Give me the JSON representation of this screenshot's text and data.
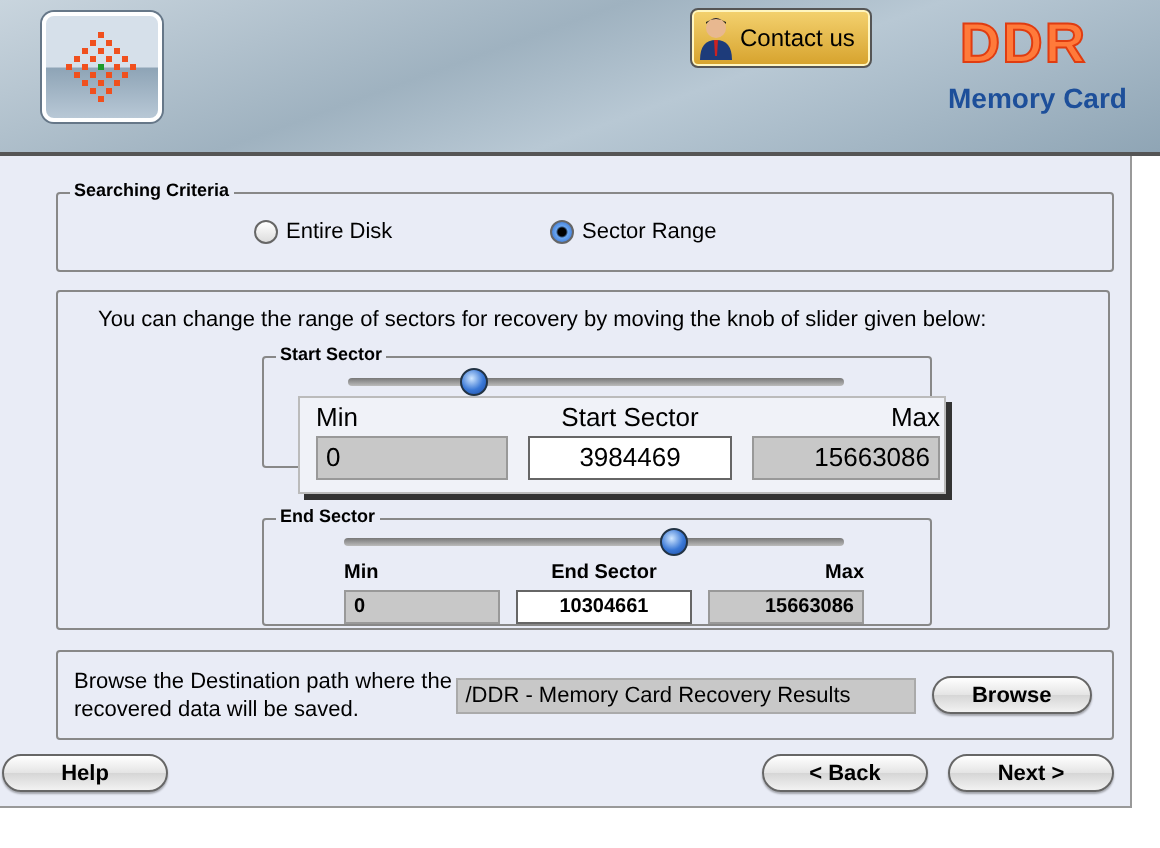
{
  "header": {
    "contact_button": "Contact us",
    "brand": "DDR",
    "product": "Memory Card"
  },
  "searching_criteria": {
    "title": "Searching Criteria",
    "options": [
      {
        "label": "Entire Disk",
        "selected": false
      },
      {
        "label": "Sector Range",
        "selected": true
      }
    ]
  },
  "sector_range": {
    "instruction": "You can change the range of sectors for recovery by moving the knob of slider given below:",
    "start_sector": {
      "title": "Start Sector",
      "level": 0.254
    },
    "magnifier": {
      "min_label": "Min",
      "value_label": "Start Sector",
      "max_label": "Max",
      "min": "0",
      "value": "3984469",
      "max": "15663086"
    },
    "end_sector": {
      "title": "End Sector",
      "level": 0.658,
      "min_label": "Min",
      "value_label": "End Sector",
      "max_label": "Max",
      "min": "0",
      "value": "10304661",
      "max": "15663086"
    }
  },
  "destination": {
    "description": "Browse the Destination path where the recovered data will be saved.",
    "path": "/DDR - Memory Card Recovery Results",
    "button": "Browse"
  },
  "buttons": {
    "help": "Help",
    "back": "< Back",
    "next": "Next >"
  }
}
